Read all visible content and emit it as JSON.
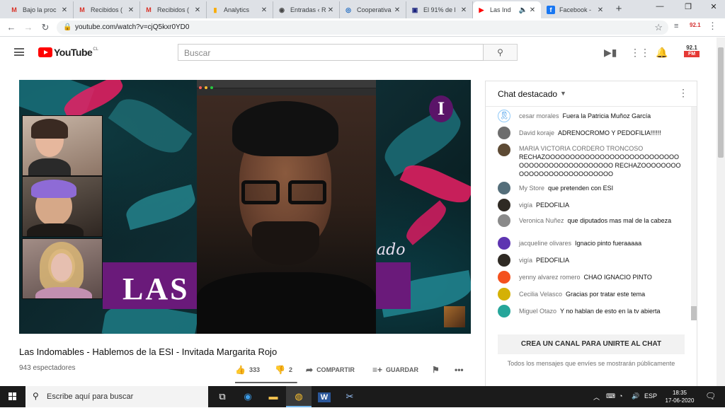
{
  "browser": {
    "tabs": [
      {
        "title": "Bajo la proc",
        "icon": "gmail-icon",
        "icon_char": "M",
        "color": "#d93025"
      },
      {
        "title": "Recibidos (",
        "icon": "gmail-icon",
        "icon_char": "M",
        "color": "#d93025"
      },
      {
        "title": "Recibidos (",
        "icon": "gmail-icon",
        "icon_char": "M",
        "color": "#d93025"
      },
      {
        "title": "Analytics",
        "icon": "analytics-icon",
        "icon_char": "▮",
        "color": "#f9ab00"
      },
      {
        "title": "Entradas ‹ R",
        "icon": "wordpress-icon",
        "icon_char": "◉",
        "color": "#464646"
      },
      {
        "title": "Cooperativa",
        "icon": "cooperativa-icon",
        "icon_char": "◎",
        "color": "#1565c0"
      },
      {
        "title": "El 91% de l",
        "icon": "news-icon",
        "icon_char": "▣",
        "color": "#1a237e"
      },
      {
        "title": "Las Ind",
        "icon": "youtube-icon",
        "icon_char": "▶",
        "color": "#ff0000",
        "active": true
      },
      {
        "title": "Facebook -",
        "icon": "facebook-icon",
        "icon_char": "f",
        "color": "#1877f2"
      }
    ],
    "url": "youtube.com/watch?v=cjQ5kxr0YD0"
  },
  "youtube": {
    "logo_text": "YouTube",
    "country": "CL",
    "search_placeholder": "Buscar",
    "channel_badge_top": "92.1",
    "channel_badge_bottom": "FM"
  },
  "video": {
    "banner_text": "LAS IN          S",
    "badge_letter": "I",
    "cursive_text": "ado",
    "title": "Las Indomables - Hablemos de la ESI - Invitada Margarita Rojo",
    "viewers": "943 espectadores",
    "likes": "333",
    "dislikes": "2",
    "share_label": "COMPARTIR",
    "save_label": "GUARDAR",
    "like_ratio": 0.994
  },
  "chat": {
    "header": "Chat destacado",
    "messages": [
      {
        "author": "cesar morales",
        "text": "Fuera la Patricia Muñoz García",
        "avatar_color": "#1e88e5"
      },
      {
        "author": "David koraje",
        "text": "ADRENOCROMO Y PEDOFILIA!!!!!!",
        "avatar_color": "#6d6d6d"
      },
      {
        "author": "MARIA VICTORIA CORDERO TRONCOSO",
        "text": "RECHAZOOOOOOOOOOOOOOOOOOOOOOOOOOOOOOOOOOOOOOOOOOOOOO RECHAZOOOOOOOOOOOOOOOOOOOOOOOOOOO",
        "avatar_color": "#5d4a34"
      },
      {
        "author": "My Store",
        "text": "que pretenden con ESI",
        "avatar_color": "#546e7a"
      },
      {
        "author": "vigía",
        "text": "PEDOFILIA",
        "avatar_color": "#2f2a24"
      },
      {
        "author": "Veronica Nuñez",
        "text": "que diputados mas mal de la cabeza",
        "avatar_color": "#8a8a8a"
      },
      {
        "author": "jacqueline olivares",
        "text": "Ignacio pinto fueraaaaa",
        "avatar_color": "#5e35b1"
      },
      {
        "author": "vigía",
        "text": "PEDOFILIA",
        "avatar_color": "#2f2a24"
      },
      {
        "author": "yenny alvarez romero",
        "text": "CHAO IGNACIO PINTO",
        "avatar_color": "#f4511e"
      },
      {
        "author": "Cecilia Velasco",
        "text": "Gracias por tratar este tema",
        "avatar_color": "#d4b106"
      },
      {
        "author": "Miguel Otazo",
        "text": "Y no hablan de esto en la tv abierta",
        "avatar_color": "#26a69a"
      }
    ],
    "create_channel_button": "CREA UN CANAL PARA UNIRTE AL CHAT",
    "notice": "Todos los mensajes que envíes se mostrarán públicamente"
  },
  "taskbar": {
    "search_placeholder": "Escribe aquí para buscar",
    "language": "ESP",
    "time": "18:35",
    "date": "17-06-2020"
  }
}
